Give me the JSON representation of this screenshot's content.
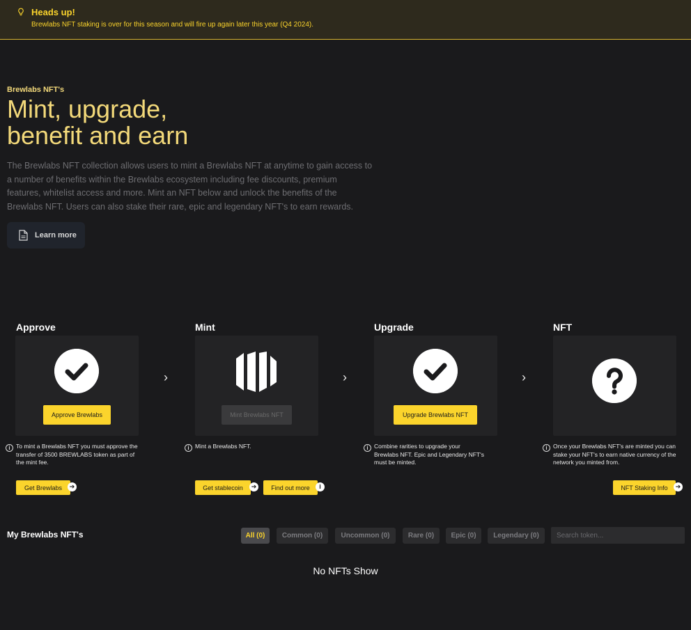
{
  "banner": {
    "title": "Heads up!",
    "message": "Brewlabs NFT staking is over for this season and will fire up again later this year (Q4 2024).",
    "icon": "bulb-icon",
    "accent": "#fbd42c"
  },
  "hero": {
    "eyebrow": "Brewlabs NFT's",
    "headline_line1": "Mint, upgrade,",
    "headline_line2": "benefit and earn",
    "description": "The Brewlabs NFT collection allows users to mint a Brewlabs NFT at anytime to gain access to a number of benefits within the Brewlabs ecosystem including fee discounts, premium features, whitelist access and more. Mint an NFT below and unlock the benefits of the Brewlabs NFT. Users can also stake their rare, epic and legendary NFT's to earn rewards.",
    "learn_more_label": "Learn more",
    "learn_more_icon": "document-icon"
  },
  "steps": [
    {
      "title": "Approve",
      "icon": "check-circle-icon",
      "button_label": "Approve Brewlabs",
      "info": "To mint a Brewlabs NFT you must approve the transfer of 3500 BREWLABS token as part of the mint fee.",
      "links": [
        {
          "label": "Get Brewlabs",
          "icon": "arrow-right-icon"
        }
      ]
    },
    {
      "title": "Mint",
      "icon": "brewlabs-logo-icon",
      "button_label": "Mint Brewlabs NFT",
      "info": "Mint a Brewlabs NFT.",
      "links": [
        {
          "label": "Get stablecoin",
          "icon": "arrow-right-icon"
        },
        {
          "label": "Find out more",
          "icon": "info-icon"
        }
      ]
    },
    {
      "title": "Upgrade",
      "icon": "check-circle-icon",
      "button_label": "Upgrade Brewlabs NFT",
      "info": "Combine rarities to upgrade your Brewlabs NFT. Epic and Legendary NFT's must be minted.",
      "links": []
    },
    {
      "title": "NFT",
      "icon": "question-circle-icon",
      "info": "Once your Brewlabs NFT's are minted you can stake your NFT's to earn native currency of the network you minted from.",
      "links": [
        {
          "label": "NFT Staking Info",
          "icon": "arrow-right-icon"
        }
      ]
    }
  ],
  "collection": {
    "title": "My Brewlabs NFT's",
    "filters": [
      "All (0)",
      "Common (0)",
      "Uncommon (0)",
      "Rare (0)",
      "Epic (0)",
      "Legendary (0)"
    ],
    "active_filter": "All (0)",
    "search_placeholder": "Search token...",
    "empty_text": "No NFTs Show"
  }
}
